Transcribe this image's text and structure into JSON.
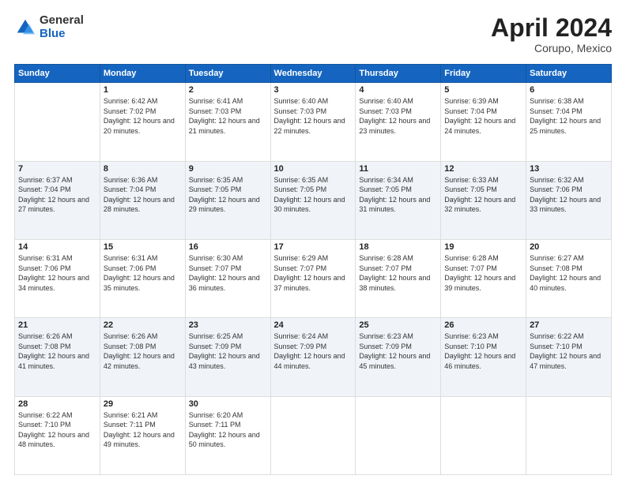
{
  "header": {
    "logo_line1": "General",
    "logo_line2": "Blue",
    "month": "April 2024",
    "location": "Corupo, Mexico"
  },
  "weekdays": [
    "Sunday",
    "Monday",
    "Tuesday",
    "Wednesday",
    "Thursday",
    "Friday",
    "Saturday"
  ],
  "weeks": [
    [
      {
        "day": "",
        "sunrise": "",
        "sunset": "",
        "daylight": ""
      },
      {
        "day": "1",
        "sunrise": "Sunrise: 6:42 AM",
        "sunset": "Sunset: 7:02 PM",
        "daylight": "Daylight: 12 hours and 20 minutes."
      },
      {
        "day": "2",
        "sunrise": "Sunrise: 6:41 AM",
        "sunset": "Sunset: 7:03 PM",
        "daylight": "Daylight: 12 hours and 21 minutes."
      },
      {
        "day": "3",
        "sunrise": "Sunrise: 6:40 AM",
        "sunset": "Sunset: 7:03 PM",
        "daylight": "Daylight: 12 hours and 22 minutes."
      },
      {
        "day": "4",
        "sunrise": "Sunrise: 6:40 AM",
        "sunset": "Sunset: 7:03 PM",
        "daylight": "Daylight: 12 hours and 23 minutes."
      },
      {
        "day": "5",
        "sunrise": "Sunrise: 6:39 AM",
        "sunset": "Sunset: 7:04 PM",
        "daylight": "Daylight: 12 hours and 24 minutes."
      },
      {
        "day": "6",
        "sunrise": "Sunrise: 6:38 AM",
        "sunset": "Sunset: 7:04 PM",
        "daylight": "Daylight: 12 hours and 25 minutes."
      }
    ],
    [
      {
        "day": "7",
        "sunrise": "Sunrise: 6:37 AM",
        "sunset": "Sunset: 7:04 PM",
        "daylight": "Daylight: 12 hours and 27 minutes."
      },
      {
        "day": "8",
        "sunrise": "Sunrise: 6:36 AM",
        "sunset": "Sunset: 7:04 PM",
        "daylight": "Daylight: 12 hours and 28 minutes."
      },
      {
        "day": "9",
        "sunrise": "Sunrise: 6:35 AM",
        "sunset": "Sunset: 7:05 PM",
        "daylight": "Daylight: 12 hours and 29 minutes."
      },
      {
        "day": "10",
        "sunrise": "Sunrise: 6:35 AM",
        "sunset": "Sunset: 7:05 PM",
        "daylight": "Daylight: 12 hours and 30 minutes."
      },
      {
        "day": "11",
        "sunrise": "Sunrise: 6:34 AM",
        "sunset": "Sunset: 7:05 PM",
        "daylight": "Daylight: 12 hours and 31 minutes."
      },
      {
        "day": "12",
        "sunrise": "Sunrise: 6:33 AM",
        "sunset": "Sunset: 7:05 PM",
        "daylight": "Daylight: 12 hours and 32 minutes."
      },
      {
        "day": "13",
        "sunrise": "Sunrise: 6:32 AM",
        "sunset": "Sunset: 7:06 PM",
        "daylight": "Daylight: 12 hours and 33 minutes."
      }
    ],
    [
      {
        "day": "14",
        "sunrise": "Sunrise: 6:31 AM",
        "sunset": "Sunset: 7:06 PM",
        "daylight": "Daylight: 12 hours and 34 minutes."
      },
      {
        "day": "15",
        "sunrise": "Sunrise: 6:31 AM",
        "sunset": "Sunset: 7:06 PM",
        "daylight": "Daylight: 12 hours and 35 minutes."
      },
      {
        "day": "16",
        "sunrise": "Sunrise: 6:30 AM",
        "sunset": "Sunset: 7:07 PM",
        "daylight": "Daylight: 12 hours and 36 minutes."
      },
      {
        "day": "17",
        "sunrise": "Sunrise: 6:29 AM",
        "sunset": "Sunset: 7:07 PM",
        "daylight": "Daylight: 12 hours and 37 minutes."
      },
      {
        "day": "18",
        "sunrise": "Sunrise: 6:28 AM",
        "sunset": "Sunset: 7:07 PM",
        "daylight": "Daylight: 12 hours and 38 minutes."
      },
      {
        "day": "19",
        "sunrise": "Sunrise: 6:28 AM",
        "sunset": "Sunset: 7:07 PM",
        "daylight": "Daylight: 12 hours and 39 minutes."
      },
      {
        "day": "20",
        "sunrise": "Sunrise: 6:27 AM",
        "sunset": "Sunset: 7:08 PM",
        "daylight": "Daylight: 12 hours and 40 minutes."
      }
    ],
    [
      {
        "day": "21",
        "sunrise": "Sunrise: 6:26 AM",
        "sunset": "Sunset: 7:08 PM",
        "daylight": "Daylight: 12 hours and 41 minutes."
      },
      {
        "day": "22",
        "sunrise": "Sunrise: 6:26 AM",
        "sunset": "Sunset: 7:08 PM",
        "daylight": "Daylight: 12 hours and 42 minutes."
      },
      {
        "day": "23",
        "sunrise": "Sunrise: 6:25 AM",
        "sunset": "Sunset: 7:09 PM",
        "daylight": "Daylight: 12 hours and 43 minutes."
      },
      {
        "day": "24",
        "sunrise": "Sunrise: 6:24 AM",
        "sunset": "Sunset: 7:09 PM",
        "daylight": "Daylight: 12 hours and 44 minutes."
      },
      {
        "day": "25",
        "sunrise": "Sunrise: 6:23 AM",
        "sunset": "Sunset: 7:09 PM",
        "daylight": "Daylight: 12 hours and 45 minutes."
      },
      {
        "day": "26",
        "sunrise": "Sunrise: 6:23 AM",
        "sunset": "Sunset: 7:10 PM",
        "daylight": "Daylight: 12 hours and 46 minutes."
      },
      {
        "day": "27",
        "sunrise": "Sunrise: 6:22 AM",
        "sunset": "Sunset: 7:10 PM",
        "daylight": "Daylight: 12 hours and 47 minutes."
      }
    ],
    [
      {
        "day": "28",
        "sunrise": "Sunrise: 6:22 AM",
        "sunset": "Sunset: 7:10 PM",
        "daylight": "Daylight: 12 hours and 48 minutes."
      },
      {
        "day": "29",
        "sunrise": "Sunrise: 6:21 AM",
        "sunset": "Sunset: 7:11 PM",
        "daylight": "Daylight: 12 hours and 49 minutes."
      },
      {
        "day": "30",
        "sunrise": "Sunrise: 6:20 AM",
        "sunset": "Sunset: 7:11 PM",
        "daylight": "Daylight: 12 hours and 50 minutes."
      },
      {
        "day": "",
        "sunrise": "",
        "sunset": "",
        "daylight": ""
      },
      {
        "day": "",
        "sunrise": "",
        "sunset": "",
        "daylight": ""
      },
      {
        "day": "",
        "sunrise": "",
        "sunset": "",
        "daylight": ""
      },
      {
        "day": "",
        "sunrise": "",
        "sunset": "",
        "daylight": ""
      }
    ]
  ]
}
